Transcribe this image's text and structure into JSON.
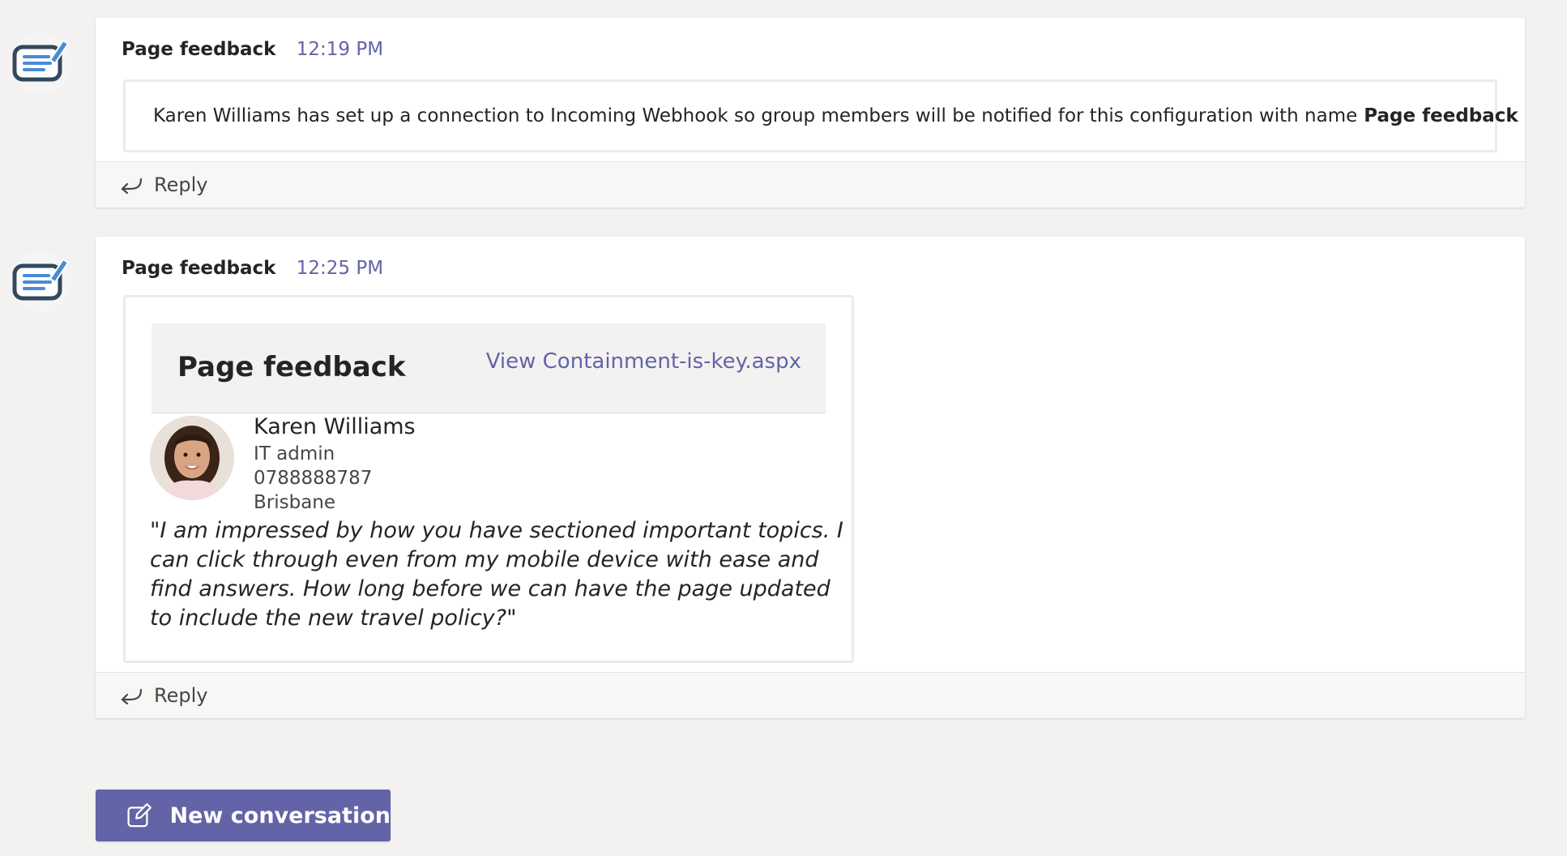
{
  "colors": {
    "accent": "#6264a7",
    "background": "#f3f2f1",
    "card": "#ffffff",
    "text": "#252423"
  },
  "messages": [
    {
      "bot_icon": "feedback-notes-icon",
      "sender": "Page feedback",
      "time": "12:19 PM",
      "text": "Karen Williams has set up a connection to Incoming Webhook so group members will be notified for this configuration with name",
      "text_bold": "Page feedback",
      "reply_label": "Reply"
    },
    {
      "bot_icon": "feedback-notes-icon",
      "sender": "Page feedback",
      "time": "12:25 PM",
      "card": {
        "title": "Page feedback",
        "link": "View Containment-is-key.aspx",
        "person": {
          "name": "Karen Williams",
          "role": "IT admin",
          "phone": "0788888787",
          "location": "Brisbane"
        },
        "quote": "\"I am impressed by how you have sectioned important topics. I can click through even from my mobile device with ease and find answers. How long before we can have the page updated to include the new travel policy?\""
      },
      "reply_label": "Reply"
    }
  ],
  "compose": {
    "new_conversation_label": "New conversation"
  }
}
